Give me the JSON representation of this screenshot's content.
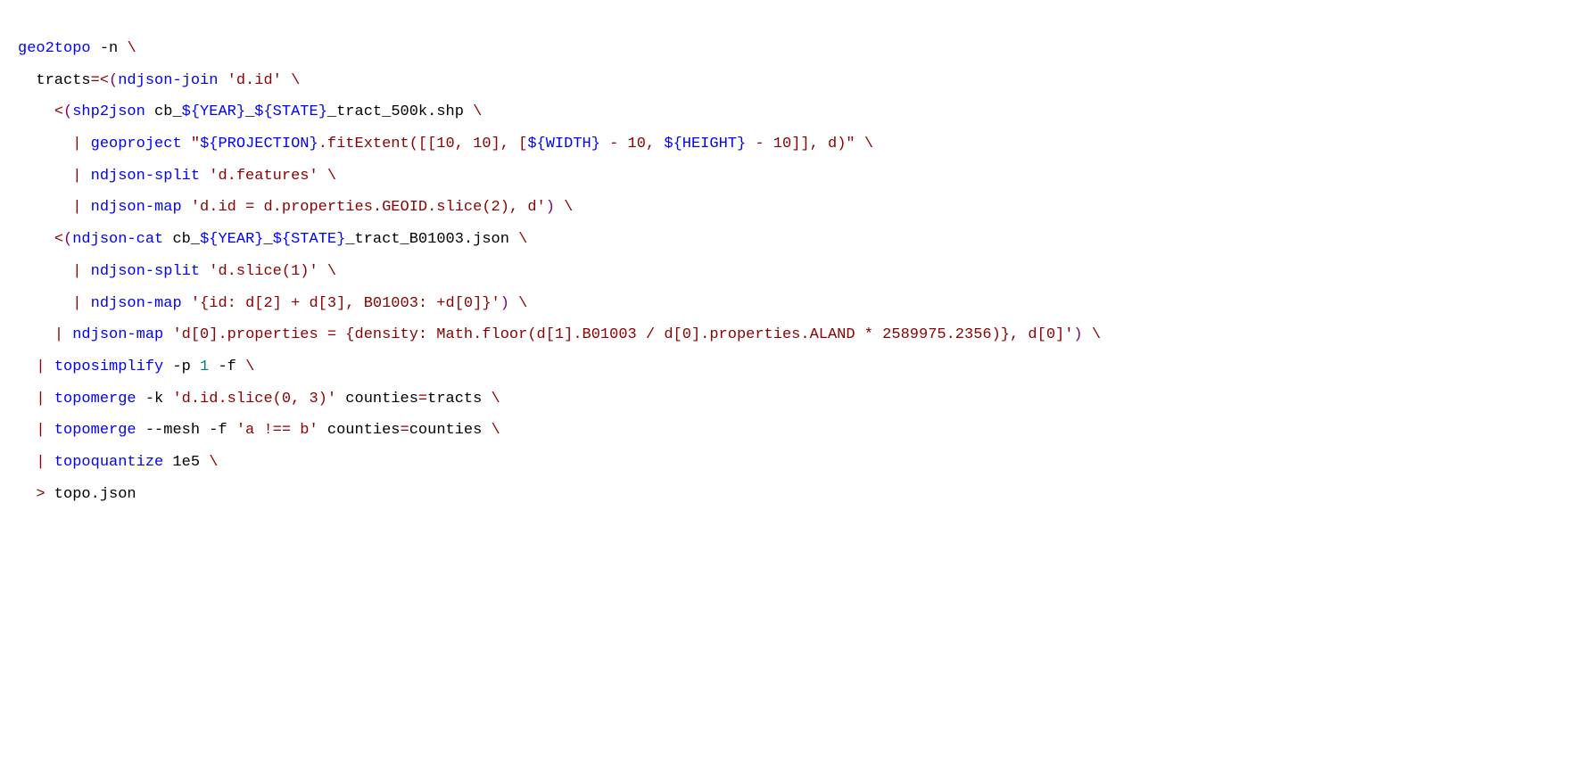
{
  "lines": [
    [
      {
        "cls": "k",
        "t": "geo2topo"
      },
      {
        "cls": "",
        "t": " -n "
      },
      {
        "cls": "p",
        "t": "\\"
      }
    ],
    [
      {
        "cls": "",
        "t": "  tracts"
      },
      {
        "cls": "p",
        "t": "="
      },
      {
        "cls": "p",
        "t": "<"
      },
      {
        "cls": "pa",
        "t": "("
      },
      {
        "cls": "k",
        "t": "ndjson-join"
      },
      {
        "cls": "",
        "t": " "
      },
      {
        "cls": "s",
        "t": "'d.id'"
      },
      {
        "cls": "",
        "t": " "
      },
      {
        "cls": "p",
        "t": "\\"
      }
    ],
    [
      {
        "cls": "",
        "t": "    "
      },
      {
        "cls": "p",
        "t": "<"
      },
      {
        "cls": "pa",
        "t": "("
      },
      {
        "cls": "k",
        "t": "shp2json"
      },
      {
        "cls": "",
        "t": " cb_"
      },
      {
        "cls": "k",
        "t": "${YEAR}"
      },
      {
        "cls": "",
        "t": "_"
      },
      {
        "cls": "k",
        "t": "${STATE}"
      },
      {
        "cls": "",
        "t": "_tract_500k.shp "
      },
      {
        "cls": "p",
        "t": "\\"
      }
    ],
    [
      {
        "cls": "",
        "t": "      "
      },
      {
        "cls": "p",
        "t": "|"
      },
      {
        "cls": "",
        "t": " "
      },
      {
        "cls": "k",
        "t": "geoproject"
      },
      {
        "cls": "",
        "t": " "
      },
      {
        "cls": "s",
        "t": "\""
      },
      {
        "cls": "k",
        "t": "${PROJECTION}"
      },
      {
        "cls": "s",
        "t": ".fitExtent([[10, 10], ["
      },
      {
        "cls": "k",
        "t": "${WIDTH}"
      },
      {
        "cls": "s",
        "t": " - 10, "
      },
      {
        "cls": "k",
        "t": "${HEIGHT}"
      },
      {
        "cls": "s",
        "t": " - 10]], d)\""
      },
      {
        "cls": "",
        "t": " "
      },
      {
        "cls": "p",
        "t": "\\"
      }
    ],
    [
      {
        "cls": "",
        "t": "      "
      },
      {
        "cls": "p",
        "t": "|"
      },
      {
        "cls": "",
        "t": " "
      },
      {
        "cls": "k",
        "t": "ndjson-split"
      },
      {
        "cls": "",
        "t": " "
      },
      {
        "cls": "s",
        "t": "'d.features'"
      },
      {
        "cls": "",
        "t": " "
      },
      {
        "cls": "p",
        "t": "\\"
      }
    ],
    [
      {
        "cls": "",
        "t": "      "
      },
      {
        "cls": "p",
        "t": "|"
      },
      {
        "cls": "",
        "t": " "
      },
      {
        "cls": "k",
        "t": "ndjson-map"
      },
      {
        "cls": "",
        "t": " "
      },
      {
        "cls": "s",
        "t": "'d.id = d.properties.GEOID.slice(2), d'"
      },
      {
        "cls": "pa",
        "t": ")"
      },
      {
        "cls": "",
        "t": " "
      },
      {
        "cls": "p",
        "t": "\\"
      }
    ],
    [
      {
        "cls": "",
        "t": "    "
      },
      {
        "cls": "p",
        "t": "<"
      },
      {
        "cls": "pa",
        "t": "("
      },
      {
        "cls": "k",
        "t": "ndjson-cat"
      },
      {
        "cls": "",
        "t": " cb_"
      },
      {
        "cls": "k",
        "t": "${YEAR}"
      },
      {
        "cls": "",
        "t": "_"
      },
      {
        "cls": "k",
        "t": "${STATE}"
      },
      {
        "cls": "",
        "t": "_tract_B01003.json "
      },
      {
        "cls": "p",
        "t": "\\"
      }
    ],
    [
      {
        "cls": "",
        "t": "      "
      },
      {
        "cls": "p",
        "t": "|"
      },
      {
        "cls": "",
        "t": " "
      },
      {
        "cls": "k",
        "t": "ndjson-split"
      },
      {
        "cls": "",
        "t": " "
      },
      {
        "cls": "s",
        "t": "'d.slice(1)'"
      },
      {
        "cls": "",
        "t": " "
      },
      {
        "cls": "p",
        "t": "\\"
      }
    ],
    [
      {
        "cls": "",
        "t": "      "
      },
      {
        "cls": "p",
        "t": "|"
      },
      {
        "cls": "",
        "t": " "
      },
      {
        "cls": "k",
        "t": "ndjson-map"
      },
      {
        "cls": "",
        "t": " "
      },
      {
        "cls": "s",
        "t": "'{id: d[2] + d[3], B01003: +d[0]}'"
      },
      {
        "cls": "pa",
        "t": ")"
      },
      {
        "cls": "",
        "t": " "
      },
      {
        "cls": "p",
        "t": "\\"
      }
    ],
    [
      {
        "cls": "",
        "t": "    "
      },
      {
        "cls": "p",
        "t": "|"
      },
      {
        "cls": "",
        "t": " "
      },
      {
        "cls": "k",
        "t": "ndjson-map"
      },
      {
        "cls": "",
        "t": " "
      },
      {
        "cls": "s",
        "t": "'d[0].properties = {density: Math.floor(d[1].B01003 / d[0].properties.ALAND * 2589975.2356)}, d[0]'"
      },
      {
        "cls": "pa",
        "t": ")"
      },
      {
        "cls": "",
        "t": " "
      },
      {
        "cls": "p",
        "t": "\\"
      }
    ],
    [
      {
        "cls": "",
        "t": "  "
      },
      {
        "cls": "p",
        "t": "|"
      },
      {
        "cls": "",
        "t": " "
      },
      {
        "cls": "k",
        "t": "toposimplify"
      },
      {
        "cls": "",
        "t": " -p "
      },
      {
        "cls": "n",
        "t": "1"
      },
      {
        "cls": "",
        "t": " -f "
      },
      {
        "cls": "p",
        "t": "\\"
      }
    ],
    [
      {
        "cls": "",
        "t": "  "
      },
      {
        "cls": "p",
        "t": "|"
      },
      {
        "cls": "",
        "t": " "
      },
      {
        "cls": "k",
        "t": "topomerge"
      },
      {
        "cls": "",
        "t": " -k "
      },
      {
        "cls": "s",
        "t": "'d.id.slice(0, 3)'"
      },
      {
        "cls": "",
        "t": " counties"
      },
      {
        "cls": "p",
        "t": "="
      },
      {
        "cls": "",
        "t": "tracts "
      },
      {
        "cls": "p",
        "t": "\\"
      }
    ],
    [
      {
        "cls": "",
        "t": "  "
      },
      {
        "cls": "p",
        "t": "|"
      },
      {
        "cls": "",
        "t": " "
      },
      {
        "cls": "k",
        "t": "topomerge"
      },
      {
        "cls": "",
        "t": " --mesh -f "
      },
      {
        "cls": "s",
        "t": "'a !== b'"
      },
      {
        "cls": "",
        "t": " counties"
      },
      {
        "cls": "p",
        "t": "="
      },
      {
        "cls": "",
        "t": "counties "
      },
      {
        "cls": "p",
        "t": "\\"
      }
    ],
    [
      {
        "cls": "",
        "t": "  "
      },
      {
        "cls": "p",
        "t": "|"
      },
      {
        "cls": "",
        "t": " "
      },
      {
        "cls": "k",
        "t": "topoquantize"
      },
      {
        "cls": "",
        "t": " 1e5 "
      },
      {
        "cls": "p",
        "t": "\\"
      }
    ],
    [
      {
        "cls": "",
        "t": "  "
      },
      {
        "cls": "p",
        "t": ">"
      },
      {
        "cls": "",
        "t": " topo.json"
      }
    ]
  ]
}
